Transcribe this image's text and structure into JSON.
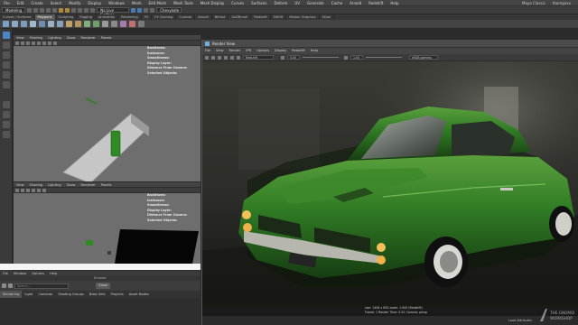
{
  "menubar": {
    "items": [
      "File",
      "Edit",
      "Create",
      "Select",
      "Modify",
      "Display",
      "Windows",
      "Mesh",
      "Edit Mesh",
      "Mesh Tools",
      "Mesh Display",
      "Curves",
      "Surfaces",
      "Deform",
      "UV",
      "Generate",
      "Cache",
      "Arnold",
      "Redshift",
      "Help"
    ],
    "workspace": "Maya Classic",
    "user": "thomgaxx"
  },
  "statusline": {
    "mode": "Modeling",
    "live_surface": "No Live Surface",
    "object_field": "Chevykote"
  },
  "shelf": {
    "tabs": [
      "Curves / Surfaces",
      "Polygons",
      "Sculpting",
      "Rigging",
      "Animation",
      "Rendering",
      "FX",
      "FX Caching",
      "Custom",
      "Arnold",
      "Bifrost",
      "GoZBrush",
      "Redshift",
      "MASH",
      "Motion Graphics",
      "XGen"
    ],
    "active_tab": 1
  },
  "viewport_top": {
    "menu": [
      "View",
      "Shading",
      "Lighting",
      "Show",
      "Renderer",
      "Panels"
    ],
    "hud": [
      {
        "label": "Backfaces:",
        "value": ""
      },
      {
        "label": "Instances:",
        "value": ""
      },
      {
        "label": "Smoothness:",
        "value": ""
      },
      {
        "label": "Display Layer:",
        "value": ""
      },
      {
        "label": "Distance From Camera:",
        "value": ""
      },
      {
        "label": "Selected Objects:",
        "value": ""
      }
    ]
  },
  "viewport_bottom": {
    "menu": [
      "View",
      "Shading",
      "Lighting",
      "Show",
      "Renderer",
      "Panels"
    ],
    "hud": [
      {
        "label": "Backfaces:",
        "value": ""
      },
      {
        "label": "Instances:",
        "value": ""
      },
      {
        "label": "Smoothness:",
        "value": ""
      },
      {
        "label": "Display Layer:",
        "value": ""
      },
      {
        "label": "Distance From Camera:",
        "value": ""
      },
      {
        "label": "Selected Objects:",
        "value": ""
      }
    ]
  },
  "hypershade": {
    "menu": [
      "File",
      "Window",
      "Options",
      "Help"
    ],
    "title": "Browser",
    "search_placeholder": "Search...",
    "show_button": "Show",
    "tabs": [
      "Rendering",
      "Light",
      "Cameras",
      "Shading Groups",
      "Bake Sets",
      "Projects",
      "Asset Nodes"
    ],
    "active_tab": 0
  },
  "render_view": {
    "title": "Render View",
    "menu": [
      "File",
      "View",
      "Render",
      "IPR",
      "Options",
      "Display",
      "Redshift",
      "Help"
    ],
    "camera": "Redshift",
    "exposure": "0.00",
    "gamma": "1.00",
    "color_space": "sRGB gamma",
    "info_line1": "size: 1408 x 850  zoom: 1.000        (Redshift)",
    "info_line2": "Frame: 1     Render Time: 0:52     Camera: persp",
    "status_right": "Load Attributes"
  },
  "colors": {
    "maya_accent": "#4a86c6",
    "car_green": "#2f7a24",
    "shelf_active": "#5d5d5d"
  },
  "watermark": "THE GNOMON WORKSHOP"
}
